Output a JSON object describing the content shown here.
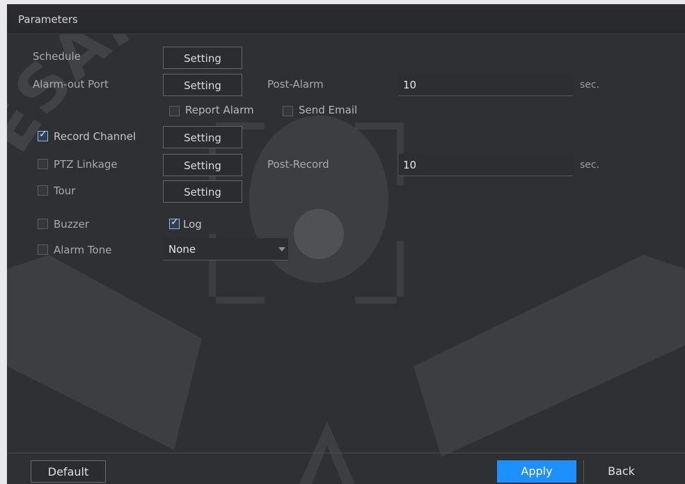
{
  "title": "Parameters",
  "rows": {
    "schedule": {
      "label": "Schedule",
      "button": "Setting"
    },
    "alarm_out": {
      "label": "Alarm-out Port",
      "button": "Setting"
    },
    "post_alarm": {
      "label": "Post-Alarm",
      "value": "10",
      "unit": "sec."
    },
    "report_alarm": {
      "label": "Report Alarm",
      "checked": false
    },
    "send_email": {
      "label": "Send Email",
      "checked": false
    },
    "record_channel": {
      "label": "Record Channel",
      "checked": true,
      "button": "Setting"
    },
    "ptz_linkage": {
      "label": "PTZ Linkage",
      "checked": false,
      "button": "Setting"
    },
    "post_record": {
      "label": "Post-Record",
      "value": "10",
      "unit": "sec."
    },
    "tour": {
      "label": "Tour",
      "checked": false,
      "button": "Setting"
    },
    "buzzer": {
      "label": "Buzzer",
      "checked": false
    },
    "log": {
      "label": "Log",
      "checked": true
    },
    "alarm_tone": {
      "label": "Alarm Tone",
      "checked": false,
      "value": "None"
    }
  },
  "footer": {
    "default": "Default",
    "apply": "Apply",
    "back": "Back"
  },
  "watermark": "ESAM SECURITY",
  "colors": {
    "background": "#2f3033",
    "accent": "#1e8fff"
  }
}
